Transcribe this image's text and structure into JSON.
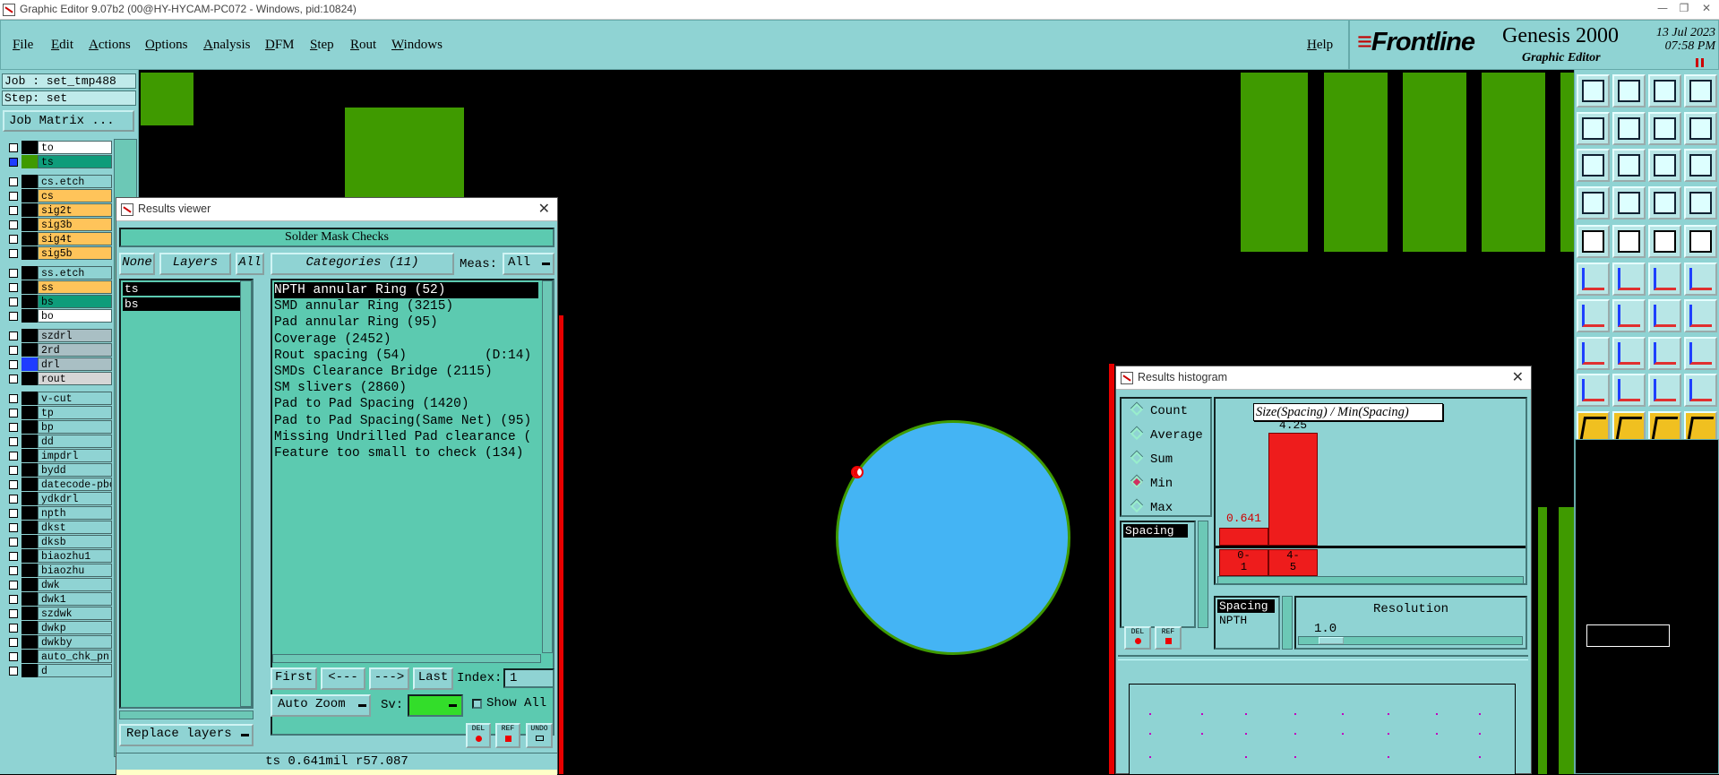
{
  "window_title": "Graphic Editor 9.07b2 (00@HY-HYCAM-PC072 - Windows, pid:10824)",
  "menu": [
    "File",
    "Edit",
    "Actions",
    "Options",
    "Analysis",
    "DFM",
    "Step",
    "Rout",
    "Windows"
  ],
  "help_label": "Help",
  "brand": {
    "logo_main": "Frontline",
    "product": "Genesis 2000",
    "subtitle": "Graphic Editor",
    "date": "13 Jul 2023",
    "time": "07:58 PM"
  },
  "job_field": "Job : set_tmp488",
  "step_field": "Step: set",
  "job_matrix_label": "Job Matrix ...",
  "layers": [
    {
      "name": "to",
      "bg": "#ffffff",
      "sw": "#000000"
    },
    {
      "name": "ts",
      "bg": "#0e9c7a",
      "sw": "#3f9a00"
    },
    {
      "name": "cs.etch",
      "bg": "#8fd3d3",
      "sw": "#000000"
    },
    {
      "name": "cs",
      "bg": "#ffc45a",
      "sw": "#000000"
    },
    {
      "name": "sig2t",
      "bg": "#ffc45a",
      "sw": "#000000"
    },
    {
      "name": "sig3b",
      "bg": "#ffc45a",
      "sw": "#000000"
    },
    {
      "name": "sig4t",
      "bg": "#ffc45a",
      "sw": "#000000"
    },
    {
      "name": "sig5b",
      "bg": "#ffc45a",
      "sw": "#000000"
    },
    {
      "name": "ss.etch",
      "bg": "#8fd3d3",
      "sw": "#000000"
    },
    {
      "name": "ss",
      "bg": "#ffc45a",
      "sw": "#000000"
    },
    {
      "name": "bs",
      "bg": "#0e9c7a",
      "sw": "#000000"
    },
    {
      "name": "bo",
      "bg": "#ffffff",
      "sw": "#000000"
    },
    {
      "name": "szdrl",
      "bg": "#a9bfc4",
      "sw": "#000000"
    },
    {
      "name": "2rd",
      "bg": "#a9bfc4",
      "sw": "#000000"
    },
    {
      "name": "drl",
      "bg": "#a9bfc4",
      "sw": "#1e3cff"
    },
    {
      "name": "rout",
      "bg": "#d6d6d6",
      "sw": "#000000"
    },
    {
      "name": "v-cut",
      "bg": "#8fd3d3",
      "sw": "#000000"
    },
    {
      "name": "tp",
      "bg": "#8fd3d3",
      "sw": "#000000"
    },
    {
      "name": "bp",
      "bg": "#8fd3d3",
      "sw": "#000000"
    },
    {
      "name": "dd",
      "bg": "#8fd3d3",
      "sw": "#000000"
    },
    {
      "name": "impdrl",
      "bg": "#8fd3d3",
      "sw": "#000000"
    },
    {
      "name": "bydd",
      "bg": "#8fd3d3",
      "sw": "#000000"
    },
    {
      "name": "datecode-pbc",
      "bg": "#8fd3d3",
      "sw": "#000000"
    },
    {
      "name": "ydkdrl",
      "bg": "#8fd3d3",
      "sw": "#000000"
    },
    {
      "name": "npth",
      "bg": "#8fd3d3",
      "sw": "#000000"
    },
    {
      "name": "dkst",
      "bg": "#8fd3d3",
      "sw": "#000000"
    },
    {
      "name": "dksb",
      "bg": "#8fd3d3",
      "sw": "#000000"
    },
    {
      "name": "biaozhu1",
      "bg": "#8fd3d3",
      "sw": "#000000"
    },
    {
      "name": "biaozhu",
      "bg": "#8fd3d3",
      "sw": "#000000"
    },
    {
      "name": "dwk",
      "bg": "#8fd3d3",
      "sw": "#000000"
    },
    {
      "name": "dwk1",
      "bg": "#8fd3d3",
      "sw": "#000000"
    },
    {
      "name": "szdwk",
      "bg": "#8fd3d3",
      "sw": "#000000"
    },
    {
      "name": "dwkp",
      "bg": "#8fd3d3",
      "sw": "#000000"
    },
    {
      "name": "dwkby",
      "bg": "#8fd3d3",
      "sw": "#000000"
    },
    {
      "name": "auto_chk_pn",
      "bg": "#8fd3d3",
      "sw": "#000000"
    },
    {
      "name": "d",
      "bg": "#8fd3d3",
      "sw": "#000000"
    }
  ],
  "results_viewer": {
    "title": "Results viewer",
    "header": "Solder Mask Checks",
    "none_btn": "None",
    "layers_btn": "Layers",
    "all_btn": "All",
    "categories_btn": "Categories (11)",
    "meas_label": "Meas:",
    "meas_value": "All",
    "layer_items": [
      "ts",
      "bs"
    ],
    "categories": [
      "NPTH annular Ring (52)",
      "SMD annular Ring (3215)",
      "Pad annular Ring (95)",
      "Coverage (2452)",
      "Rout spacing (54)          (D:14)",
      "SMDs Clearance Bridge (2115)",
      "SM slivers (2860)",
      "Pad to Pad Spacing (1420)",
      "Pad to Pad Spacing(Same Net) (95)",
      "Missing Undrilled Pad clearance (",
      "Feature too small to check (134)"
    ],
    "nav": {
      "first": "First",
      "prev": "<---",
      "next": "--->",
      "last": "Last",
      "index_label": "Index:",
      "index_value": "1"
    },
    "auto_zoom": "Auto Zoom",
    "sv_label": "Sv:",
    "show_all": "Show All",
    "replace_layers": "Replace layers",
    "del": "DEL",
    "ref": "REF",
    "undo": "UNDO",
    "status": "ts 0.641mil  r57.087"
  },
  "histogram": {
    "title": "Results histogram",
    "options": [
      "Count",
      "Average",
      "Sum",
      "Min",
      "Max"
    ],
    "selected": "Min",
    "list_items": [
      "Spacing"
    ],
    "chart_title": "Size(Spacing) / Min(Spacing)",
    "bars": [
      {
        "label": "0-1",
        "value": "0.641"
      },
      {
        "label": "4-5",
        "value": "4.25"
      }
    ],
    "bar_labels_split": [
      [
        "0-",
        "1"
      ],
      [
        "4-",
        "5"
      ]
    ],
    "type_items": [
      "Spacing",
      "NPTH"
    ],
    "resolution_label": "Resolution",
    "resolution_value": "1.0",
    "del": "DEL",
    "ref": "REF"
  }
}
